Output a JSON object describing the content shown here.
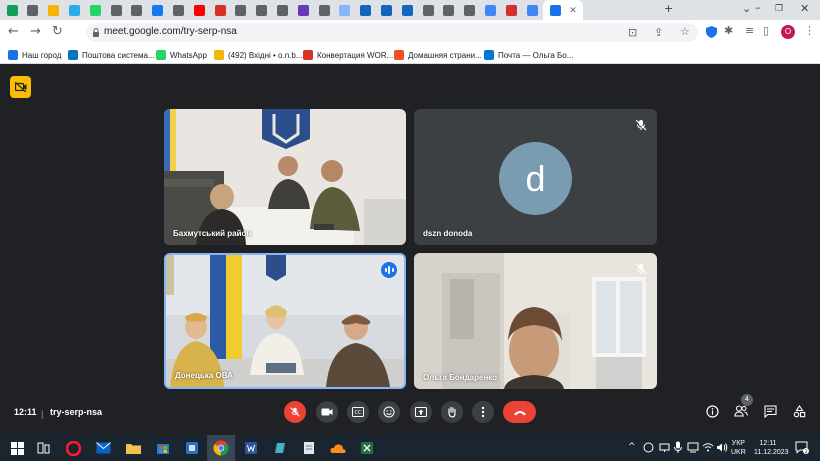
{
  "browser": {
    "url": "meet.google.com/try-serp-nsa",
    "tabs": [
      {
        "icon": "sheets-icon",
        "color": "#0f9d58"
      },
      {
        "icon": "chrome-tab-icon",
        "color": "#5f6368"
      },
      {
        "icon": "folder-icon",
        "color": "#f4b400"
      },
      {
        "icon": "telegram-icon",
        "color": "#2aabee"
      },
      {
        "icon": "whatsapp-icon",
        "color": "#25d366"
      },
      {
        "icon": "chrome-tab-icon",
        "color": "#5f6368"
      },
      {
        "icon": "chrome-tab-icon",
        "color": "#5f6368"
      },
      {
        "icon": "facebook-icon",
        "color": "#1877f2"
      },
      {
        "icon": "chrome-tab-icon",
        "color": "#5f6368"
      },
      {
        "icon": "youtube-icon",
        "color": "#ff0000"
      },
      {
        "icon": "heart-icon",
        "color": "#d93025"
      },
      {
        "icon": "chrome-tab-icon",
        "color": "#5f6368"
      },
      {
        "icon": "chrome-tab-icon",
        "color": "#5f6368"
      },
      {
        "icon": "chrome-tab-icon",
        "color": "#5f6368"
      },
      {
        "icon": "forms-icon",
        "color": "#673ab7"
      },
      {
        "icon": "chrome-tab-icon",
        "color": "#5f6368"
      },
      {
        "icon": "site-icon",
        "color": "#8ab4f8"
      },
      {
        "icon": "site-icon",
        "color": "#1565c0"
      },
      {
        "icon": "site-icon",
        "color": "#1565c0"
      },
      {
        "icon": "emblem-icon",
        "color": "#1565c0"
      },
      {
        "icon": "chrome-tab-icon",
        "color": "#5f6368"
      },
      {
        "icon": "chrome-tab-icon",
        "color": "#5f6368"
      },
      {
        "icon": "chrome-tab-icon",
        "color": "#5f6368"
      },
      {
        "icon": "google-icon",
        "color": "#4285f4"
      },
      {
        "icon": "tsn-icon",
        "color": "#d32f2f"
      },
      {
        "icon": "google-icon",
        "color": "#4285f4"
      }
    ],
    "profile_initial": "O",
    "bookmarks": [
      {
        "label": "Наш город",
        "color": "#1a73e8"
      },
      {
        "label": "Поштова система...",
        "color": "#0277bd"
      },
      {
        "label": "WhatsApp",
        "color": "#25d366"
      },
      {
        "label": "(492) Вхідні • o.n.b...",
        "color": "#f4b400"
      },
      {
        "label": "Конвертация WOR...",
        "color": "#d93025"
      },
      {
        "label": "Домашняя страни...",
        "color": "#f25022"
      },
      {
        "label": "Почта — Ольга Бо...",
        "color": "#0078d4"
      }
    ]
  },
  "meet": {
    "participants": [
      {
        "name": "Бахмутський район",
        "muted": false,
        "speaking": false,
        "type": "video-office"
      },
      {
        "name": "dszn donoda",
        "muted": true,
        "speaking": false,
        "type": "avatar",
        "initial": "d",
        "avatar_color": "#7a9cb0"
      },
      {
        "name": "Донецька ОВА",
        "muted": false,
        "speaking": true,
        "type": "video-flag"
      },
      {
        "name": "Ольга Бондаренко",
        "muted": true,
        "speaking": false,
        "type": "video-room"
      }
    ],
    "time": "12:11",
    "separator": "|",
    "meeting_code": "try-serp-nsa",
    "people_count": "4",
    "accent": "#1a73e8",
    "danger": "#ea4335"
  },
  "taskbar": {
    "lang_line1": "УКР",
    "lang_line2": "UKR",
    "time": "12:11",
    "date": "11.12.2023",
    "notifications": "2"
  }
}
